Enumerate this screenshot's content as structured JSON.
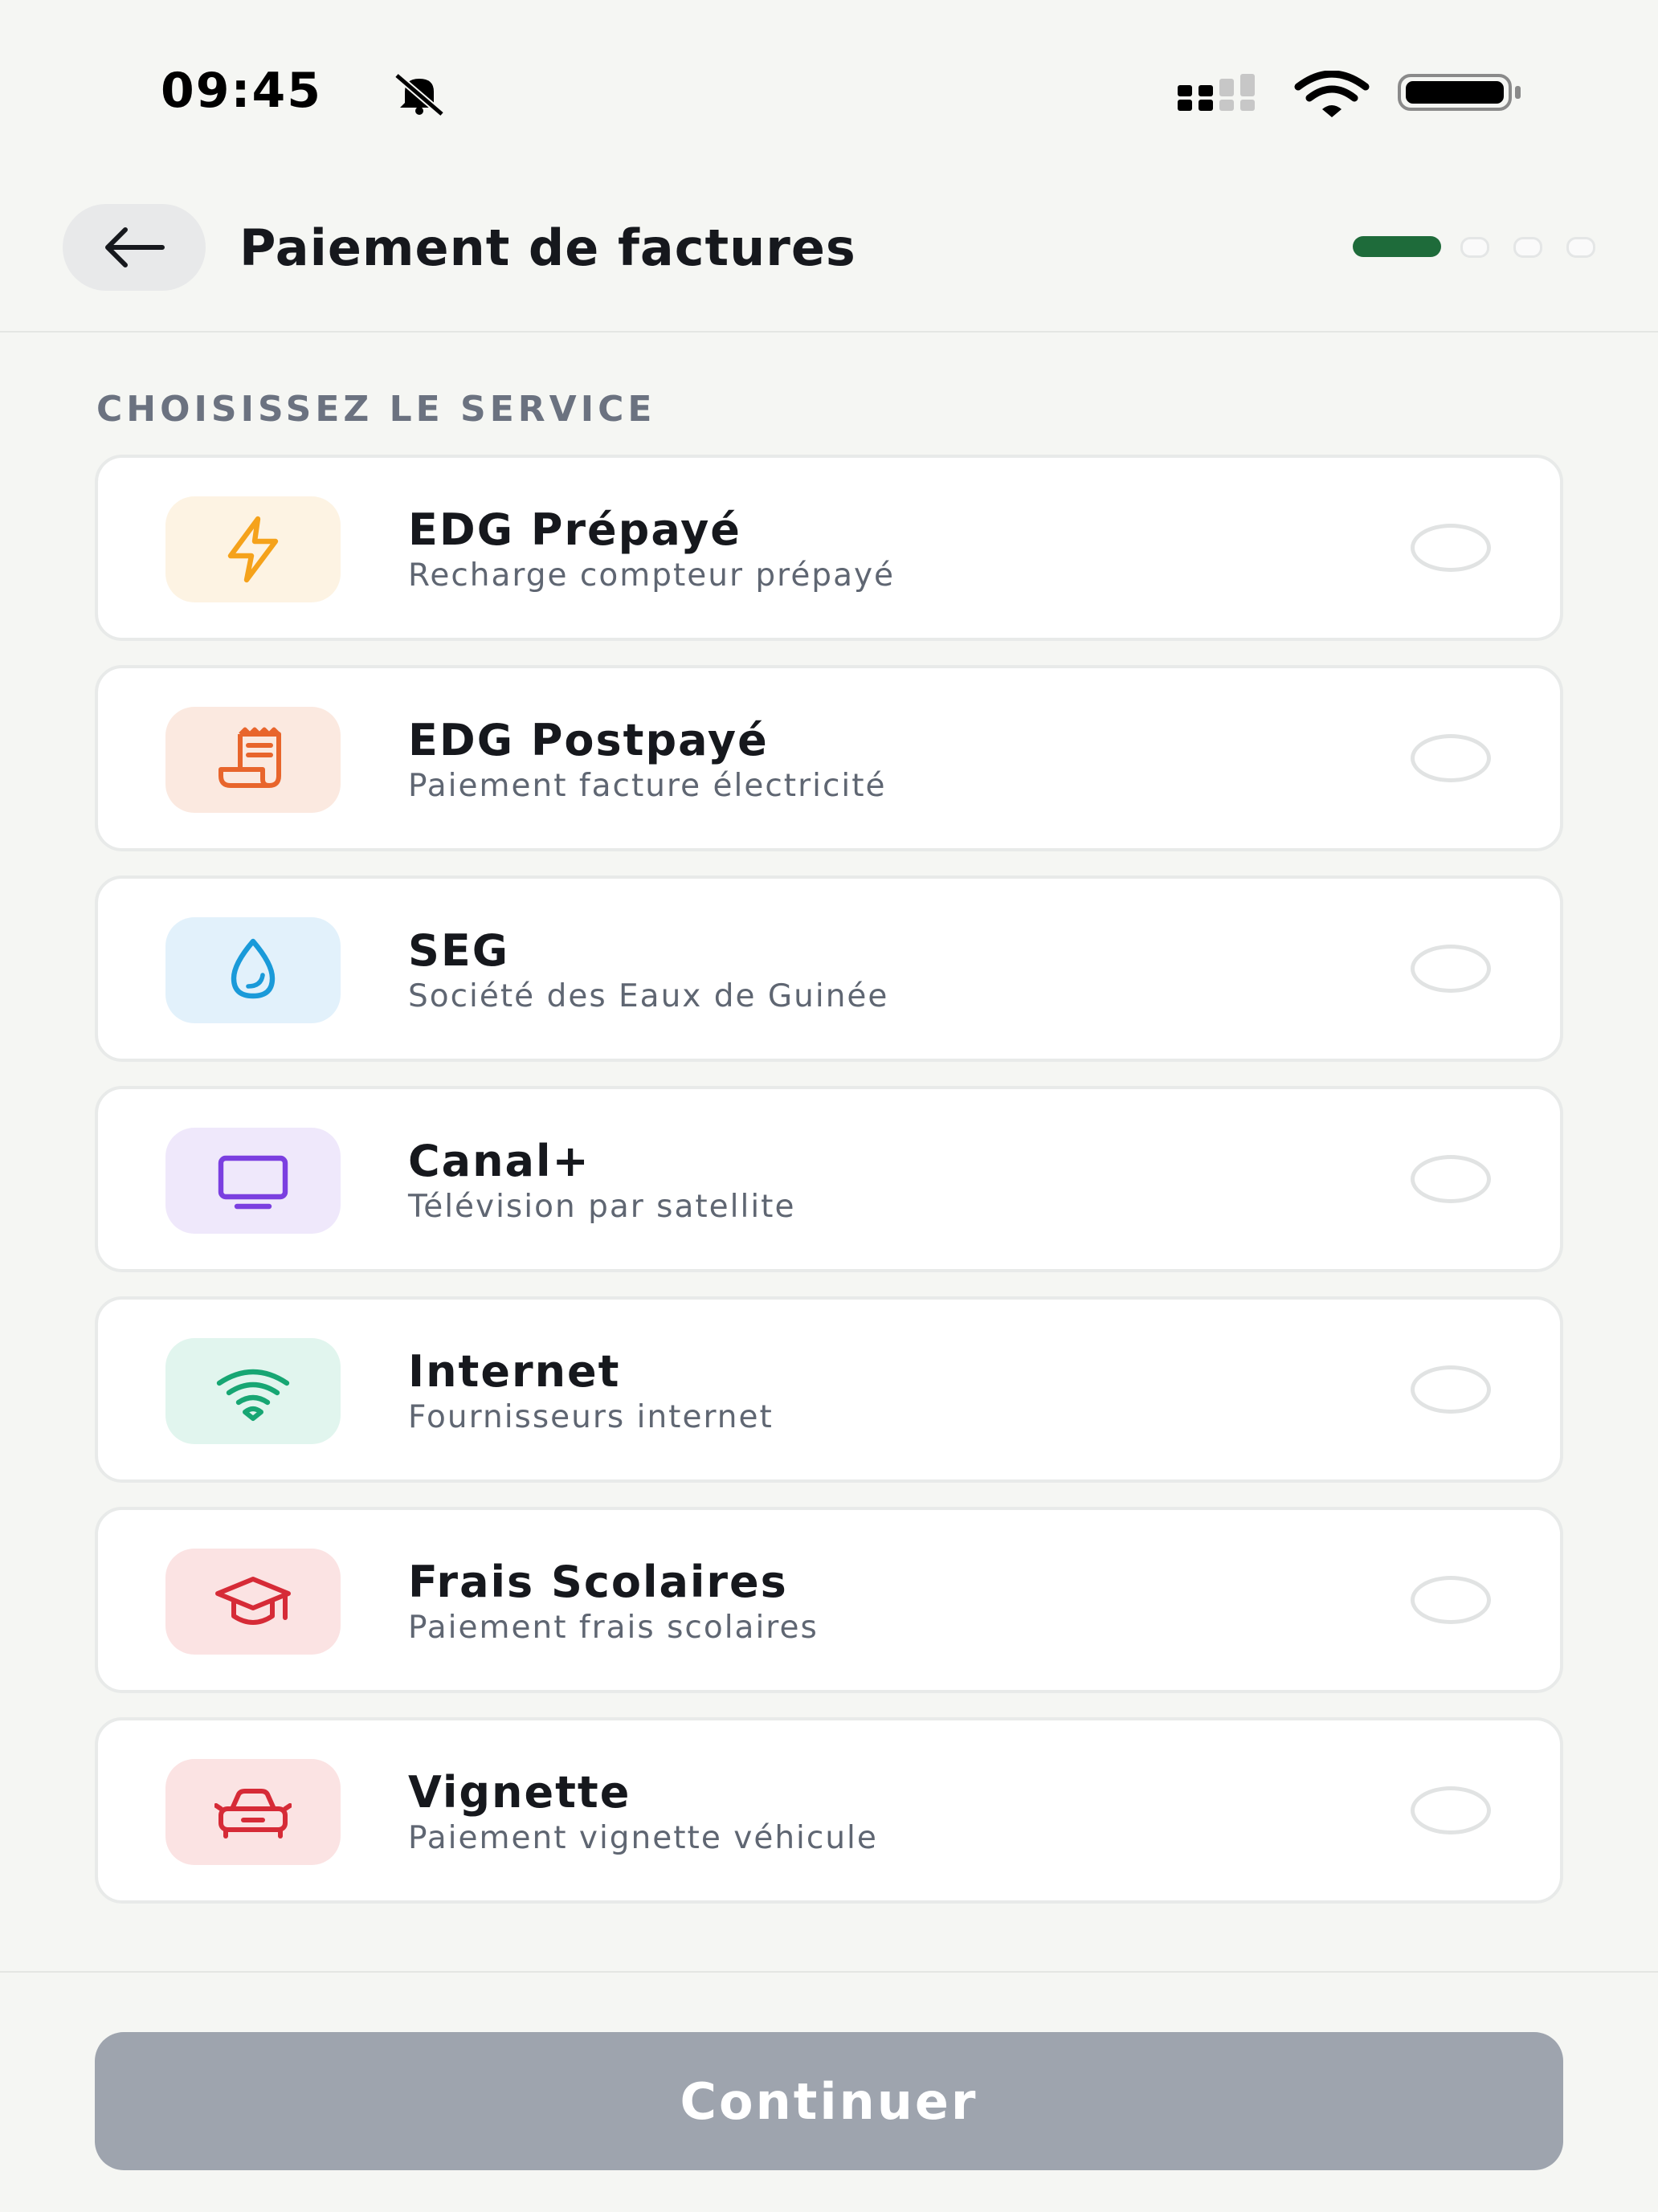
{
  "status_bar": {
    "time": "09:45",
    "icons": [
      "bell-slash-icon",
      "cellular-signal-icon",
      "wifi-icon",
      "battery-icon"
    ]
  },
  "header": {
    "title": "Paiement de factures",
    "back_icon": "arrow-left-icon",
    "steps_total": 4,
    "current_step": 1,
    "accent_color": "#1e6b3a"
  },
  "section": {
    "label": "CHOISISSEZ LE SERVICE"
  },
  "services": [
    {
      "title": "EDG Prépayé",
      "subtitle": "Recharge compteur prépayé",
      "icon": "lightning-bolt-icon",
      "color": "#f5a21b",
      "tile_color": "#fdf3e3",
      "selected": false
    },
    {
      "title": "EDG Postpayé",
      "subtitle": "Paiement facture électricité",
      "icon": "receipt-icon",
      "color": "#e8652c",
      "tile_color": "#fbe9e0",
      "selected": false
    },
    {
      "title": "SEG",
      "subtitle": "Société des Eaux de Guinée",
      "icon": "water-drop-icon",
      "color": "#1a9ad9",
      "tile_color": "#e2f1fb",
      "selected": false
    },
    {
      "title": "Canal+",
      "subtitle": "Télévision par satellite",
      "icon": "tv-icon",
      "color": "#7b3fe0",
      "tile_color": "#efe8fb",
      "selected": false
    },
    {
      "title": "Internet",
      "subtitle": "Fournisseurs internet",
      "icon": "wifi-icon",
      "color": "#17a673",
      "tile_color": "#e1f5ee",
      "selected": false
    },
    {
      "title": "Frais Scolaires",
      "subtitle": "Paiement frais scolaires",
      "icon": "graduation-cap-icon",
      "color": "#d62b37",
      "tile_color": "#fbe3e3",
      "selected": false
    },
    {
      "title": "Vignette",
      "subtitle": "Paiement vignette véhicule",
      "icon": "car-icon",
      "color": "#d62b37",
      "tile_color": "#fbe3e3",
      "selected": false
    }
  ],
  "footer": {
    "continue_label": "Continuer",
    "button_color": "#9ea4ae"
  }
}
